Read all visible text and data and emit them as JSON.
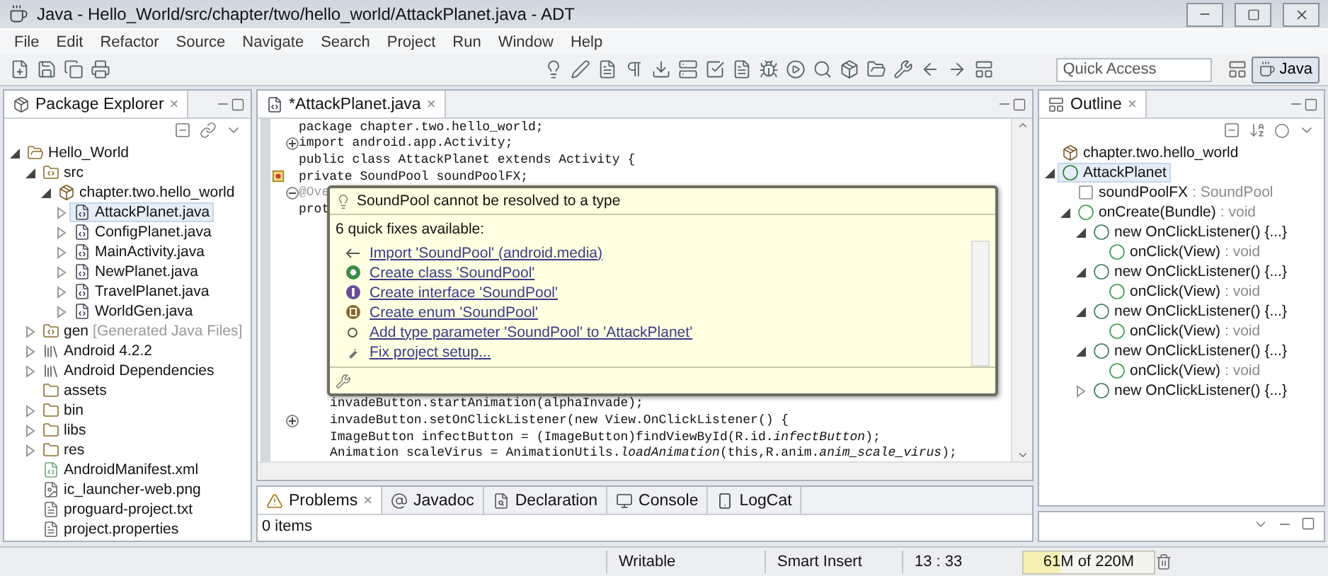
{
  "window": {
    "title": "Java - Hello_World/src/chapter/two/hello_world/AttackPlanet.java - ADT"
  },
  "menu": [
    "File",
    "Edit",
    "Refactor",
    "Source",
    "Navigate",
    "Search",
    "Project",
    "Run",
    "Window",
    "Help"
  ],
  "toolbar": {
    "quick_access": {
      "placeholder": "Quick Access"
    },
    "perspective": {
      "label": "Java",
      "selected": true
    }
  },
  "package_explorer": {
    "title": "Package Explorer",
    "close": "×",
    "items": [
      {
        "label": "Hello_World",
        "kind": "project",
        "expanded": true,
        "selected": false,
        "children": [
          {
            "label": "src",
            "kind": "srcfolder",
            "expanded": true,
            "selected": false,
            "children": [
              {
                "label": "chapter.two.hello_world",
                "kind": "package",
                "expanded": true,
                "selected": false,
                "children": [
                  {
                    "label": "AttackPlanet.java",
                    "kind": "java",
                    "expanded": false,
                    "selected": true
                  },
                  {
                    "label": "ConfigPlanet.java",
                    "kind": "java",
                    "expanded": false,
                    "selected": false
                  },
                  {
                    "label": "MainActivity.java",
                    "kind": "java",
                    "expanded": false,
                    "selected": false
                  },
                  {
                    "label": "NewPlanet.java",
                    "kind": "java",
                    "expanded": false,
                    "selected": false
                  },
                  {
                    "label": "TravelPlanet.java",
                    "kind": "java",
                    "expanded": false,
                    "selected": false
                  },
                  {
                    "label": "WorldGen.java",
                    "kind": "java",
                    "expanded": false,
                    "selected": false
                  }
                ]
              }
            ]
          },
          {
            "label": "gen",
            "decoration": "[Generated Java Files]",
            "kind": "srcfolder",
            "expanded": false,
            "selected": false
          },
          {
            "label": "Android 4.2.2",
            "kind": "library",
            "expanded": false,
            "selected": false
          },
          {
            "label": "Android Dependencies",
            "kind": "library",
            "expanded": false,
            "selected": false
          },
          {
            "label": "assets",
            "kind": "folder",
            "selected": false
          },
          {
            "label": "bin",
            "kind": "folder",
            "expanded": false,
            "selected": false
          },
          {
            "label": "libs",
            "kind": "folder",
            "expanded": false,
            "selected": false
          },
          {
            "label": "res",
            "kind": "folder",
            "expanded": false,
            "selected": false
          },
          {
            "label": "AndroidManifest.xml",
            "kind": "xml",
            "selected": false
          },
          {
            "label": "ic_launcher-web.png",
            "kind": "image",
            "selected": false
          },
          {
            "label": "proguard-project.txt",
            "kind": "file",
            "selected": false
          },
          {
            "label": "project.properties",
            "kind": "file",
            "selected": false
          }
        ]
      }
    ]
  },
  "editor": {
    "tab": {
      "label": "*AttackPlanet.java",
      "close": "×",
      "selected": true
    },
    "code_top": [
      {
        "text": "package chapter.two.hello_world;",
        "indented": false
      },
      {
        "text": "import android.app.Activity;",
        "indented": false,
        "collapsed": true
      },
      {
        "text": "public class AttackPlanet extends Activity {",
        "indented": false
      },
      {
        "text": "private SoundPool soundPoolFX;",
        "indented": false,
        "error": true
      },
      {
        "text": "@Ove",
        "indented": false,
        "collapsed": false,
        "annotation": true
      },
      {
        "text": "prot",
        "indented": false
      }
    ],
    "code_bottom": [
      {
        "text": "invadeButton.startAnimation(alphaInvade);",
        "indented": true
      },
      {
        "text": "invadeButton.setOnClickListener(new View.OnClickListener() {",
        "indented": true,
        "collapsed": true
      },
      {
        "text": "ImageButton infectButton = (ImageButton)findViewById(R.id.*infectButton*);",
        "indented": true
      },
      {
        "text": "Animation scaleVirus = AnimationUtils.*loadAnimation*(this,R.anim.*anim_scale_virus*);",
        "indented": true
      }
    ],
    "quick_fix": {
      "problem": "SoundPool cannot be resolved to a type",
      "summary": "6 quick fixes available:",
      "fixes": [
        {
          "label": "Import 'SoundPool' (android.media)",
          "kind": "import"
        },
        {
          "label": "Create class 'SoundPool'",
          "kind": "class"
        },
        {
          "label": "Create interface 'SoundPool'",
          "kind": "interface"
        },
        {
          "label": "Create enum 'SoundPool'",
          "kind": "enum"
        },
        {
          "label": "Add type parameter 'SoundPool' to 'AttackPlanet'",
          "kind": "parameter"
        },
        {
          "label": "Fix project setup...",
          "kind": "setup"
        }
      ]
    }
  },
  "bottom_panel": {
    "tabs": [
      {
        "label": "Problems",
        "kind": "problems",
        "selected": true,
        "close": "×"
      },
      {
        "label": "Javadoc",
        "kind": "javadoc",
        "selected": false
      },
      {
        "label": "Declaration",
        "kind": "declaration",
        "selected": false
      },
      {
        "label": "Console",
        "kind": "console",
        "selected": false
      },
      {
        "label": "LogCat",
        "kind": "logcat",
        "selected": false
      }
    ],
    "status": "0 items"
  },
  "outline": {
    "title": "Outline",
    "close": "×",
    "items": [
      {
        "label": "chapter.two.hello_world",
        "kind": "package",
        "selected": false
      },
      {
        "label": "AttackPlanet",
        "kind": "class",
        "expanded": true,
        "selected": true,
        "children": [
          {
            "label": "soundPoolFX",
            "type": " : SoundPool",
            "kind": "field",
            "selected": false
          },
          {
            "label": "onCreate(Bundle)",
            "type": " : void",
            "kind": "method",
            "expanded": true,
            "selected": false,
            "children": [
              {
                "label": "new OnClickListener() {...}",
                "kind": "anonymous",
                "expanded": true,
                "selected": false,
                "children": [
                  {
                    "label": "onClick(View)",
                    "type": " : void",
                    "kind": "method",
                    "selected": false
                  }
                ]
              },
              {
                "label": "new OnClickListener() {...}",
                "kind": "anonymous",
                "expanded": true,
                "selected": false,
                "children": [
                  {
                    "label": "onClick(View)",
                    "type": " : void",
                    "kind": "method",
                    "selected": false
                  }
                ]
              },
              {
                "label": "new OnClickListener() {...}",
                "kind": "anonymous",
                "expanded": true,
                "selected": false,
                "children": [
                  {
                    "label": "onClick(View)",
                    "type": " : void",
                    "kind": "method",
                    "selected": false
                  }
                ]
              },
              {
                "label": "new OnClickListener() {...}",
                "kind": "anonymous",
                "expanded": true,
                "selected": false,
                "children": [
                  {
                    "label": "onClick(View)",
                    "type": " : void",
                    "kind": "method",
                    "selected": false
                  }
                ]
              },
              {
                "label": "new OnClickListener() {...}",
                "kind": "anonymous",
                "expanded": false,
                "selected": false
              }
            ]
          }
        ]
      }
    ]
  },
  "status_bar": {
    "mode": "Writable",
    "insert": "Smart Insert",
    "position": "13 : 33",
    "heap": {
      "reading": "61M of 220M",
      "level": 0.28
    }
  }
}
